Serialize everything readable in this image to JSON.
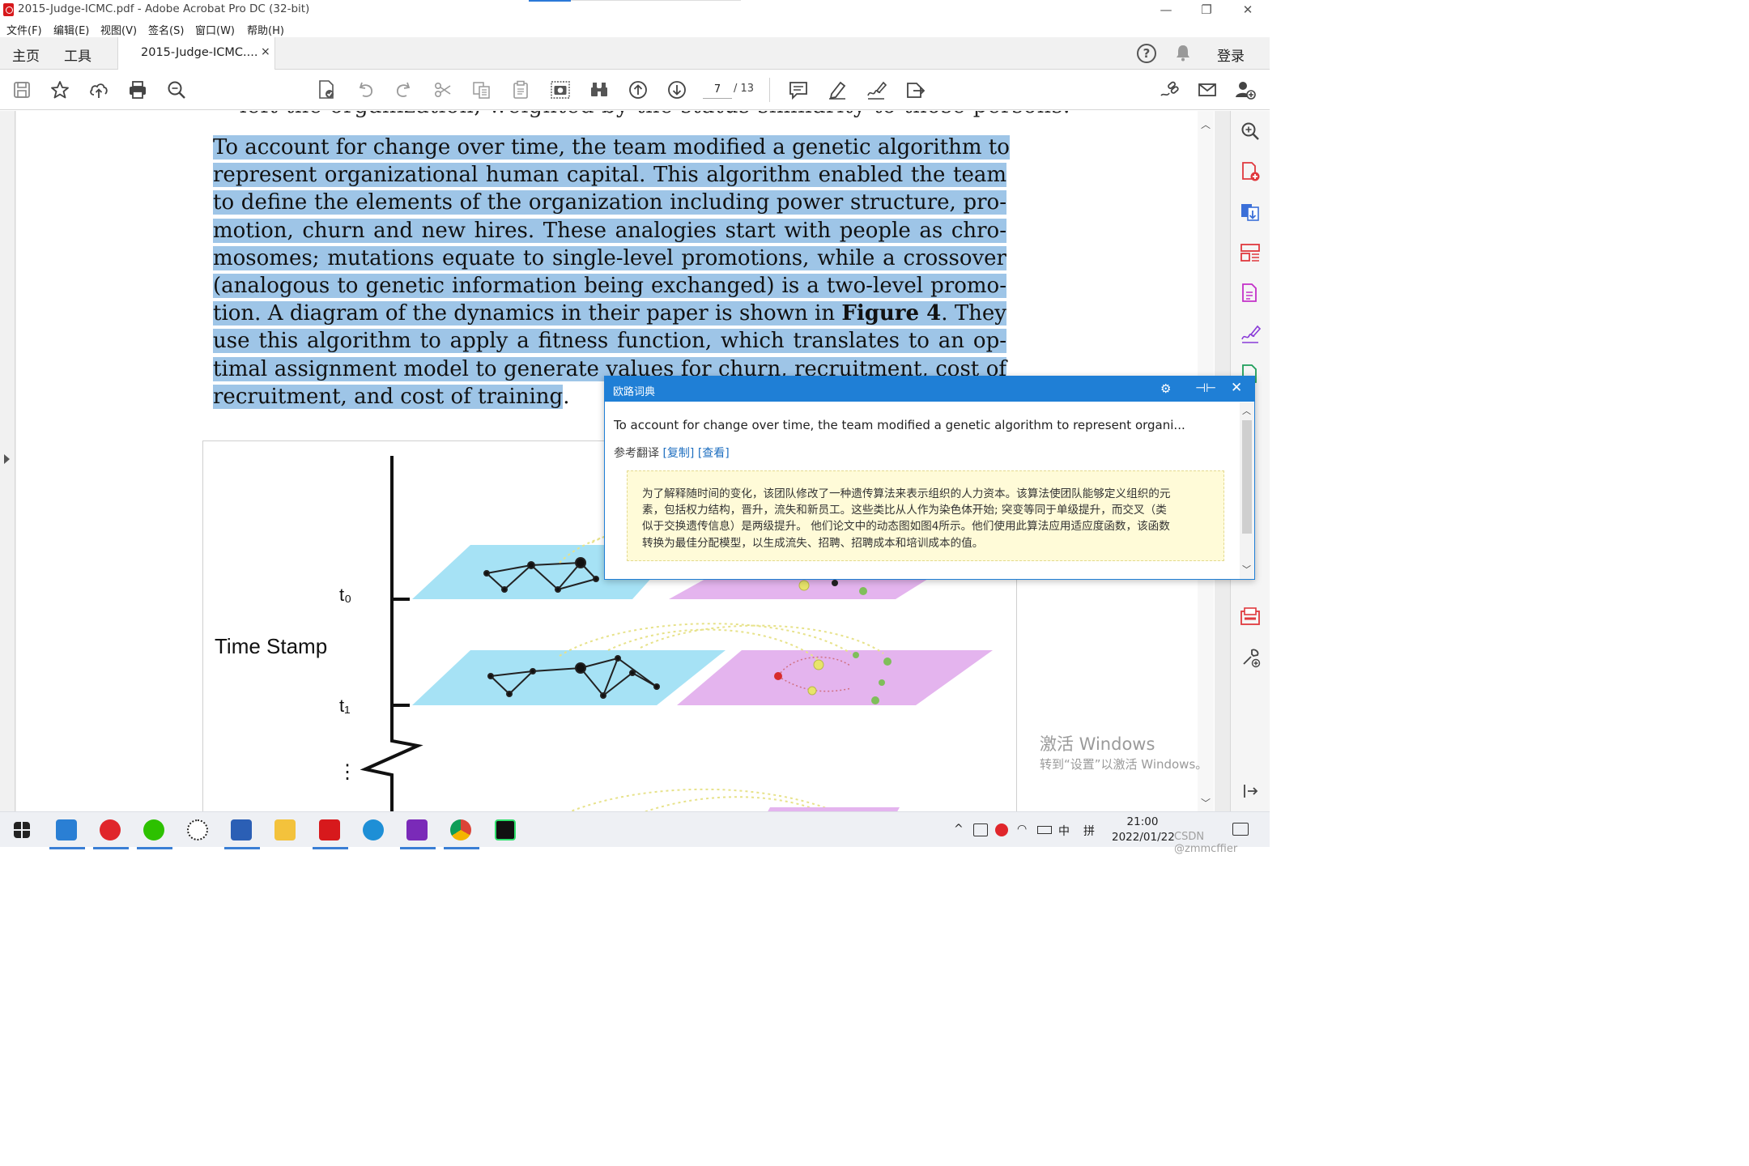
{
  "window": {
    "title": "2015-Judge-ICMC.pdf - Adobe Acrobat Pro DC (32-bit)",
    "minimize": "—",
    "restore": "❐",
    "close": "✕"
  },
  "menu": [
    "文件(F)",
    "编辑(E)",
    "视图(V)",
    "签名(S)",
    "窗口(W)",
    "帮助(H)"
  ],
  "tabs": {
    "home": "主页",
    "tools": "工具",
    "doc_tab": "2015-Judge-ICMC....",
    "doc_close": "×",
    "help": "?",
    "login": "登录"
  },
  "toolbar": {
    "current_page": "7",
    "total_pages": "/ 13",
    "icons": [
      "save-icon",
      "star-icon",
      "upload-icon",
      "print-icon",
      "zoom-search-icon",
      "spellcheck-icon",
      "undo-icon",
      "redo-icon",
      "scissors-icon",
      "copy-format-icon",
      "paste-icon",
      "snapshot-icon",
      "binoculars-icon",
      "page-up-icon",
      "page-down-icon",
      "comment-icon",
      "highlight-pen-icon",
      "sign-icon",
      "share-icon",
      "link-icon",
      "email-icon",
      "add-user-icon"
    ]
  },
  "document": {
    "previous_line": "left the organization, weighted by the status similarity to those persons.",
    "paragraph_lines": [
      "To account for change over time, the team modified a genetic algorithm to",
      "represent organizational human capital.  This algorithm enabled the team",
      "to define the elements of the organization including power structure, pro-",
      "motion, churn and new hires.  These analogies start with people as chro-",
      "mosomes; mutations equate to single-level promotions, while a crossover",
      "(analogous to genetic information being exchanged) is a two-level promo-",
      "tion.  A diagram of the dynamics in their paper is shown in",
      "use this algorithm to apply a fitness function, which translates to an op-",
      "timal assignment model to generate values for churn, recruitment, cost of",
      "recruitment, and cost of training"
    ],
    "line7_bold": "Figure 4",
    "line7_tail": ".  They",
    "line10_tail": ".",
    "figure": {
      "y_label": "Time Stamp",
      "t0": "t₀",
      "t1": "t₁",
      "ellipsis": "⋮"
    }
  },
  "dictionary_popup": {
    "title": "欧路词典",
    "source_text": "To account for change over time, the team modified a genetic algorithm to represent organi...",
    "ref_label": "参考翻译",
    "copy_link": "[复制]",
    "view_link": "[查看]",
    "translation_lines": [
      "为了解释随时间的变化，该团队修改了一种遗传算法来表示组织的人力资本。该算法使团队能够定义组织的元",
      "素，包括权力结构，晋升，流失和新员工。这些类比从人作为染色体开始; 突变等同于单级提升，而交叉（类",
      "似于交换遗传信息）是两级提升。 他们论文中的动态图如图4所示。他们使用此算法应用适应度函数，该函数",
      "转换为最佳分配模型，以生成流失、招聘、招聘成本和培训成本的值。"
    ]
  },
  "watermark": {
    "line1": "激活 Windows",
    "line2": "转到“设置”以激活 Windows。"
  },
  "taskbar": {
    "tray": [
      "^",
      "中",
      "拼"
    ],
    "time": "21:00",
    "date": "2022/01/22",
    "csdn": "CSDN @zmmcffier",
    "apps": [
      "start-icon",
      "dictionary-app-icon",
      "netease-music-icon",
      "wechat-icon",
      "kwai-icon",
      "word-icon",
      "file-explorer-icon",
      "acrobat-icon",
      "edge-icon",
      "onenote-icon",
      "chrome-icon",
      "pycharm-icon"
    ]
  },
  "colors": {
    "selection": "#9ec5e7",
    "popup_accent": "#1f7fd6",
    "translation_bg": "#fffbd8"
  }
}
